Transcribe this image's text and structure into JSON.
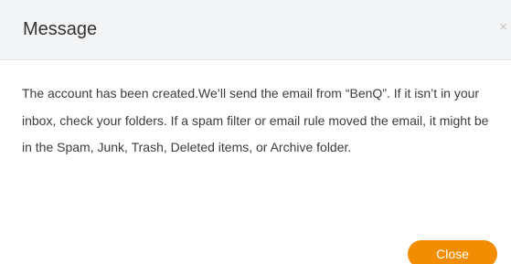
{
  "dialog": {
    "title": "Message",
    "close_icon": "×",
    "message": "The account has been created.We’ll send the email from “BenQ”. If it isn’t in your inbox, check your folders. If a spam filter or email rule moved the email, it might be in the Spam, Junk, Trash, Deleted items, or Archive folder.",
    "close_button_label": "Close"
  },
  "colors": {
    "header_bg": "#f3f4f6",
    "accent": "#f28c00"
  }
}
